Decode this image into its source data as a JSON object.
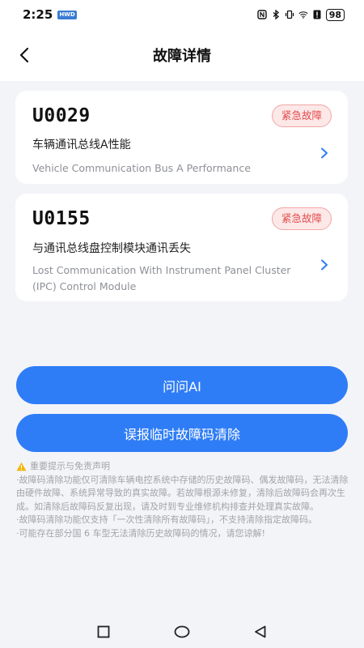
{
  "status_bar": {
    "time": "2:25",
    "hwd_badge": "HWD",
    "battery": "98"
  },
  "header": {
    "title": "故障详情"
  },
  "faults": [
    {
      "code": "U0029",
      "severity": "紧急故障",
      "title_cn": "车辆通讯总线A性能",
      "title_en": "Vehicle Communication Bus A Performance"
    },
    {
      "code": "U0155",
      "severity": "紧急故障",
      "title_cn": "与通讯总线盘控制模块通讯丢失",
      "title_en": "Lost Communication With Instrument Panel Cluster (IPC) Control Module"
    }
  ],
  "actions": {
    "ask_ai": "问问AI",
    "clear_codes": "误报临时故障码清除"
  },
  "notice": {
    "heading": "重要提示与免责声明",
    "p1": "·故障码清除功能仅可清除车辆电控系统中存储的历史故障码、偶发故障码，无法清除由硬件故障、系统异常导致的真实故障。若故障根源未修复，清除后故障码会再次生成。如清除后故障码反复出现，请及时到专业维修机构排查并处理真实故障。",
    "p2": "·故障码清除功能仅支持「一次性清除所有故障码」，不支持清除指定故障码。",
    "p3": "·可能存在部分国 6 车型无法清除历史故障码的情况，请您谅解!"
  },
  "colors": {
    "accent": "#2f7df6",
    "severity_text": "#e24c4c",
    "severity_bg": "#fde8e8",
    "page_bg": "#f3f4f8"
  },
  "icons": {
    "back": "chevron-left-icon",
    "row_arrow": "chevron-right-icon",
    "warning": "warning-icon"
  }
}
